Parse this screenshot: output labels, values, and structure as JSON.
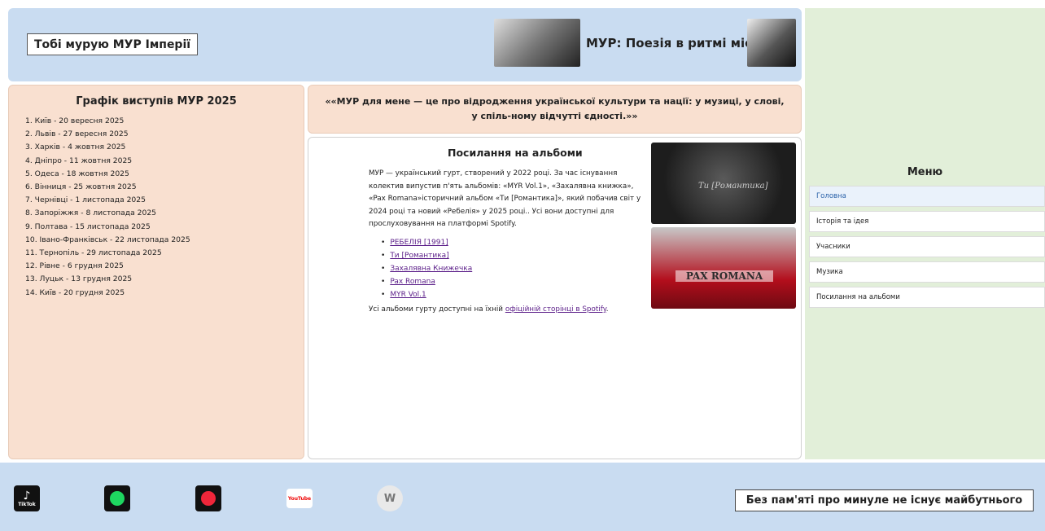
{
  "header": {
    "slogan": "Тобі мурую МУР Імперії",
    "title": "МУР: Поезія в ритмі міста"
  },
  "schedule": {
    "title": "Графік виступів МУР 2025",
    "items": [
      "1. Київ - 20 вересня 2025",
      "2. Львів - 27 вересня 2025",
      "3. Харків - 4 жовтня 2025",
      "4. Дніпро - 11 жовтня 2025",
      "5. Одеса - 18 жовтня 2025",
      "6. Вінниця - 25 жовтня 2025",
      "7. Чернівці - 1 листопада 2025",
      "8. Запоріжжя - 8 листопада 2025",
      "9. Полтава - 15 листопада 2025",
      "10. Івано-Франківськ - 22 листопада 2025",
      "11. Тернопіль - 29 листопада 2025",
      "12. Рівне - 6 грудня 2025",
      "13. Луцьк - 13 грудня 2025",
      "14. Київ - 20 грудня 2025"
    ]
  },
  "quote": "««МУР для мене — це про відродження української культури та нації: у музиці, у слові, у спіль-ному відчутті єдності.»»",
  "albums": {
    "title": "Посилання на альбоми",
    "text": "МУР — український гурт, створений у 2022 році. За час існування колектив випустив п'ять альбомів: «MYR Vol.1», «Захалявна книжка», «Pax Romana»історичний альбом «Ти [Романтика]», який побачив світ у 2024 році та новий «Ребелія» у 2025 році.. Усі вони доступні для прослуховування на платформі Spotify.",
    "links": [
      "РЕБЕЛІЯ [1991]",
      "Ти [Романтика]",
      "Захалявна Книжечка",
      "Pax Romana",
      "MYR Vol.1"
    ],
    "note_prefix": "Усі альбоми гурту доступні на їхній ",
    "note_link": "офіційній сторінці в Spotify",
    "cover1_text": "Ти [Романтика]",
    "cover2_text": "PAX ROMANA"
  },
  "menu": {
    "title": "Меню",
    "items": [
      "Головна",
      "Історія та ідея",
      "Учасники",
      "Музика",
      "Посилання на альбоми"
    ],
    "active_color": "#2a62a9"
  },
  "footer": {
    "motto": "Без пам'яті про минуле не існує майбутнього",
    "social": [
      {
        "name": "tiktok-icon",
        "label": "TikTok"
      },
      {
        "name": "spotify-icon",
        "label": ""
      },
      {
        "name": "concert-icon",
        "label": ""
      },
      {
        "name": "youtube-icon",
        "label": "YouTube"
      },
      {
        "name": "wikipedia-icon",
        "label": ""
      }
    ]
  }
}
